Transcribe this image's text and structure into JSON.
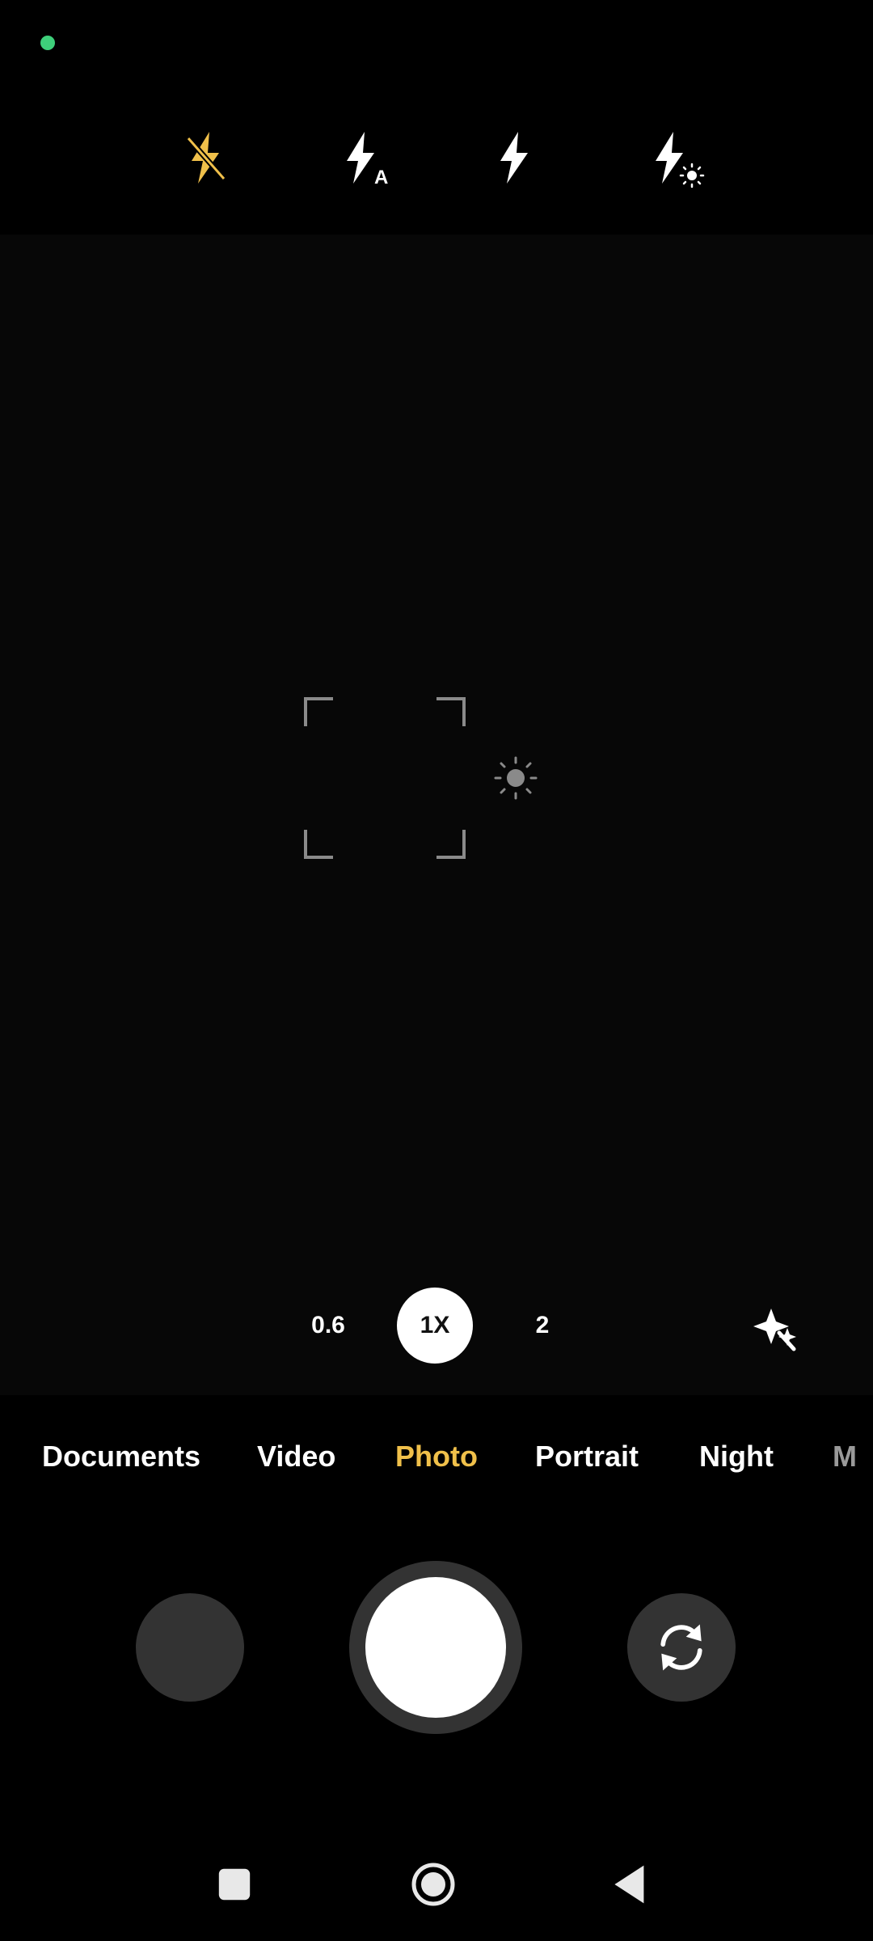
{
  "colors": {
    "background": "#000000",
    "viewfinder": "#070707",
    "accent": "#f0c04a",
    "status_dot": "#3ecf7a",
    "button_gray": "#333333",
    "text": "#ffffff"
  },
  "flash_modes": [
    {
      "icon": "flash-off-icon",
      "selected": true
    },
    {
      "icon": "flash-auto-icon",
      "selected": false
    },
    {
      "icon": "flash-on-icon",
      "selected": false
    },
    {
      "icon": "flash-torch-icon",
      "selected": false
    }
  ],
  "viewfinder": {
    "focus_icon": "focus-frame-icon",
    "exposure_icon": "exposure-sun-icon"
  },
  "zoom": {
    "options": [
      "0.6",
      "1X",
      "2"
    ],
    "selected": "1X"
  },
  "ai_icon": "magic-sparkle-icon",
  "modes": {
    "items": [
      "Documents",
      "Video",
      "Photo",
      "Portrait",
      "Night",
      "M"
    ],
    "selected": "Photo"
  },
  "controls": {
    "gallery_icon": "gallery-thumbnail",
    "shutter_icon": "shutter-button",
    "switch_icon": "switch-camera-icon"
  },
  "nav": {
    "recents_icon": "recents-square-icon",
    "home_icon": "home-circle-icon",
    "back_icon": "back-triangle-icon"
  }
}
